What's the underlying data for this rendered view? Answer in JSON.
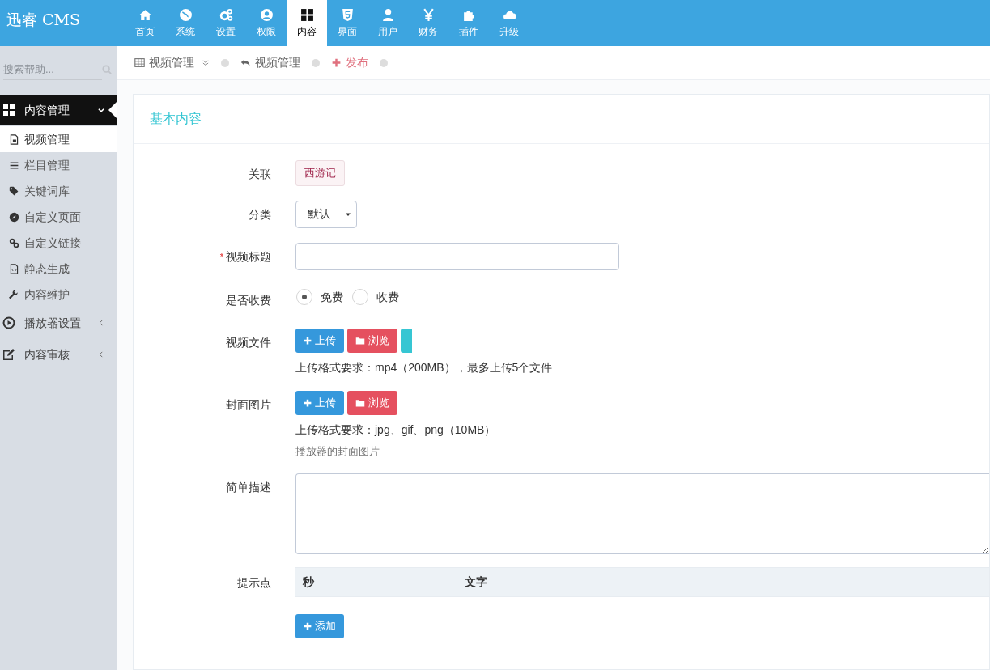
{
  "logo": "迅睿 CMS",
  "nav": [
    {
      "label": "首页",
      "selected": false
    },
    {
      "label": "系统",
      "selected": false
    },
    {
      "label": "设置",
      "selected": false
    },
    {
      "label": "权限",
      "selected": false
    },
    {
      "label": "内容",
      "selected": true
    },
    {
      "label": "界面",
      "selected": false
    },
    {
      "label": "用户",
      "selected": false
    },
    {
      "label": "财务",
      "selected": false
    },
    {
      "label": "插件",
      "selected": false
    },
    {
      "label": "升级",
      "selected": false
    }
  ],
  "sidebar": {
    "search": {
      "placeholder": "搜索帮助..."
    },
    "groups": [
      {
        "label": "内容管理",
        "expanded": true,
        "children": [
          {
            "label": "视频管理",
            "selected": true
          },
          {
            "label": "栏目管理",
            "selected": false
          },
          {
            "label": "关键词库",
            "selected": false
          },
          {
            "label": "自定义页面",
            "selected": false
          },
          {
            "label": "自定义链接",
            "selected": false
          },
          {
            "label": "静态生成",
            "selected": false
          },
          {
            "label": "内容维护",
            "selected": false
          }
        ]
      },
      {
        "label": "播放器设置",
        "expanded": false
      },
      {
        "label": "内容审核",
        "expanded": false
      }
    ]
  },
  "breadcrumb": [
    {
      "label": "视频管理",
      "kind": "menu"
    },
    {
      "label": "视频管理",
      "kind": "back"
    },
    {
      "label": "发布",
      "kind": "add"
    }
  ],
  "panel": {
    "title": "基本内容",
    "fields": [
      {
        "label": "关联",
        "kind": "tag",
        "value": "西游记"
      },
      {
        "label": "分类",
        "kind": "select",
        "value": "默认"
      },
      {
        "label": "视频标题",
        "kind": "text",
        "required_mark": "*"
      },
      {
        "label": "是否收费",
        "kind": "radio",
        "options": [
          {
            "label": "免费",
            "selected": true
          },
          {
            "label": "收费",
            "selected": false
          }
        ]
      },
      {
        "label": "视频文件",
        "kind": "upload",
        "buttons": [
          {
            "label": "上传",
            "kind": "upload"
          },
          {
            "label": "浏览",
            "kind": "browse"
          },
          {
            "kind": "partial"
          }
        ],
        "hints": [
          {
            "text": "上传格式要求：mp4（200MB），最多上传5个文件",
            "kind": "rule"
          }
        ]
      },
      {
        "label": "封面图片",
        "kind": "upload",
        "buttons": [
          {
            "label": "上传",
            "kind": "upload"
          },
          {
            "label": "浏览",
            "kind": "browse"
          }
        ],
        "hints": [
          {
            "text": "上传格式要求：jpg、gif、png（10MB）",
            "kind": "rule"
          },
          {
            "text": "播放器的封面图片",
            "kind": "note"
          }
        ]
      },
      {
        "label": "简单描述",
        "kind": "textarea"
      },
      {
        "label": "提示点",
        "kind": "table",
        "columns": [
          "秒",
          "文字"
        ],
        "add_button": "添加"
      }
    ]
  }
}
